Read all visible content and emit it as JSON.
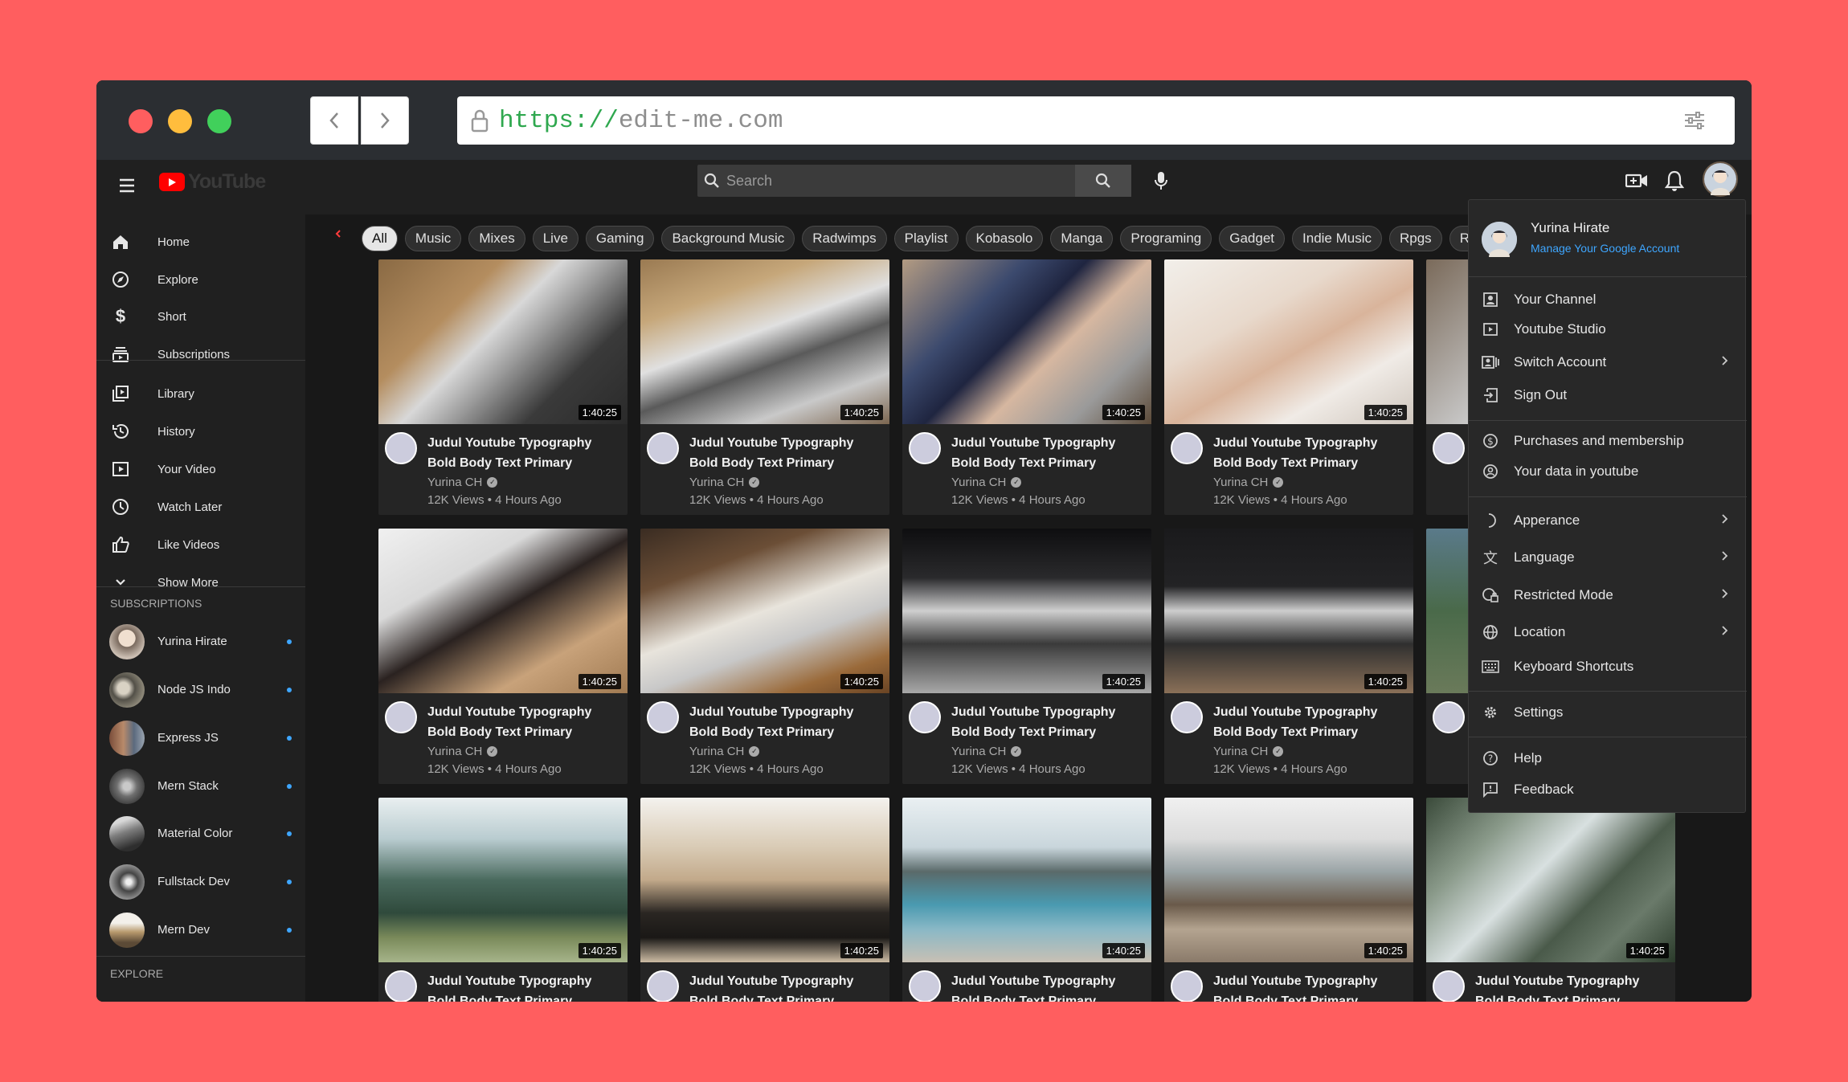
{
  "browser": {
    "url_scheme": "https://",
    "url_host": "edit-me.com"
  },
  "header": {
    "logo_text": "YouTube",
    "search_placeholder": "Search"
  },
  "sidebar": {
    "items": [
      {
        "label": "Home",
        "icon": "home-icon"
      },
      {
        "label": "Explore",
        "icon": "compass-icon"
      },
      {
        "label": "Short",
        "icon": "dollar-icon"
      },
      {
        "label": "Subscriptions",
        "icon": "subscriptions-icon"
      },
      {
        "label": "Library",
        "icon": "library-icon"
      },
      {
        "label": "History",
        "icon": "history-icon"
      },
      {
        "label": "Your Video",
        "icon": "play-square-icon"
      },
      {
        "label": "Watch Later",
        "icon": "clock-icon"
      },
      {
        "label": "Like Videos",
        "icon": "thumbs-up-icon"
      },
      {
        "label": "Show More",
        "icon": "chevron-down-icon"
      }
    ],
    "subscriptions_heading": "SUBSCRIPTIONS",
    "subscriptions": [
      {
        "label": "Yurina Hirate"
      },
      {
        "label": "Node JS Indo"
      },
      {
        "label": "Express JS"
      },
      {
        "label": "Mern Stack"
      },
      {
        "label": "Material Color"
      },
      {
        "label": "Fullstack Dev"
      },
      {
        "label": "Mern Dev"
      }
    ],
    "explore_heading": "EXPLORE"
  },
  "chips": [
    "All",
    "Music",
    "Mixes",
    "Live",
    "Gaming",
    "Background Music",
    "Radwimps",
    "Playlist",
    "Kobasolo",
    "Manga",
    "Programing",
    "Gadget",
    "Indie Music",
    "Rpgs",
    "Role Playing"
  ],
  "video": {
    "title": "Judul Youtube Typography Bold Body Text Primary",
    "channel": "Yurina CH",
    "meta": "12K Views  •  4 Hours Ago",
    "duration": "1:40:25"
  },
  "menu": {
    "name": "Yurina Hirate",
    "manage": "Manage Your Google Account",
    "items": [
      {
        "label": "Your Channel"
      },
      {
        "label": "Youtube Studio"
      },
      {
        "label": "Switch Account"
      },
      {
        "label": "Sign Out"
      },
      {
        "label": "Purchases and membership"
      },
      {
        "label": "Your data in youtube"
      },
      {
        "label": "Apperance"
      },
      {
        "label": "Language"
      },
      {
        "label": "Restricted Mode"
      },
      {
        "label": "Location"
      },
      {
        "label": "Keyboard Shortcuts"
      },
      {
        "label": "Settings"
      },
      {
        "label": "Help"
      },
      {
        "label": "Feedback"
      }
    ]
  },
  "colors": {
    "background": "#ff5e5f",
    "accent": "#3ea6ff",
    "brand_red": "#ff0000"
  }
}
